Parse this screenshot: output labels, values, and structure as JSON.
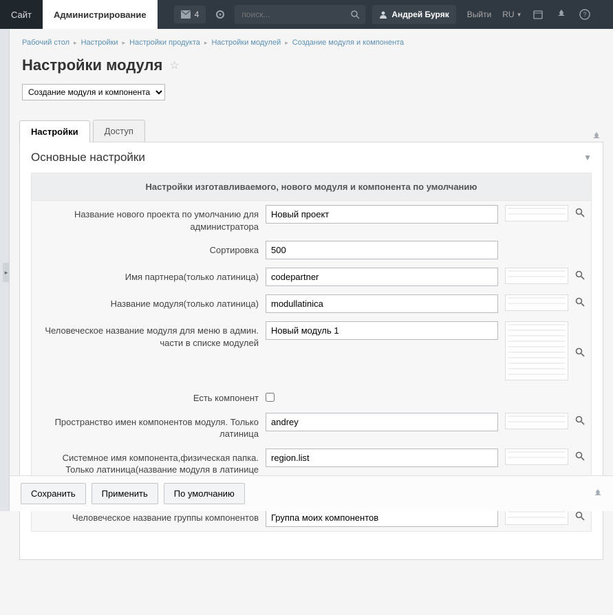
{
  "topbar": {
    "tab_site": "Сайт",
    "tab_admin": "Администрирование",
    "notif_count": "4",
    "search_placeholder": "поиск...",
    "user_name": "Андрей Буряк",
    "logout": "Выйти",
    "lang": "RU"
  },
  "breadcrumbs": [
    "Рабочий стол",
    "Настройки",
    "Настройки продукта",
    "Настройки модулей",
    "Создание модуля и компонента"
  ],
  "page_title": "Настройки модуля",
  "page_select_value": "Создание модуля и компонента",
  "tabs": {
    "settings": "Настройки",
    "access": "Доступ"
  },
  "panel": {
    "title": "Основные настройки"
  },
  "section_title": "Настройки изготавливаемого, нового модуля и компонента по умолчанию",
  "fields": {
    "project_name": {
      "label": "Название нового проекта по умолчанию для администратора",
      "value": "Новый проект"
    },
    "sort": {
      "label": "Сортировка",
      "value": "500"
    },
    "partner": {
      "label": "Имя партнера(только латиница)",
      "value": "codepartner"
    },
    "module_lat": {
      "label": "Название модуля(только латиница)",
      "value": "modullatinica"
    },
    "module_human": {
      "label": "Человеческое название модуля для меню в админ. части в списке модулей",
      "value": "Новый модуль 1"
    },
    "has_component": {
      "label": "Есть компонент"
    },
    "namespace": {
      "label": "Пространство имен компонентов модуля. Только латиница",
      "value": "andrey"
    },
    "sys_name": {
      "label": "Системное имя компонента,физическая папка. Только латиница(название модуля в латинице подставится автоматически в начале названия папки через точку)",
      "value": "region.list"
    },
    "group_human": {
      "label": "Человеческое название группы компонентов",
      "value": "Группа моих компонентов"
    }
  },
  "footer": {
    "save": "Сохранить",
    "apply": "Применить",
    "reset": "По умолчанию"
  }
}
